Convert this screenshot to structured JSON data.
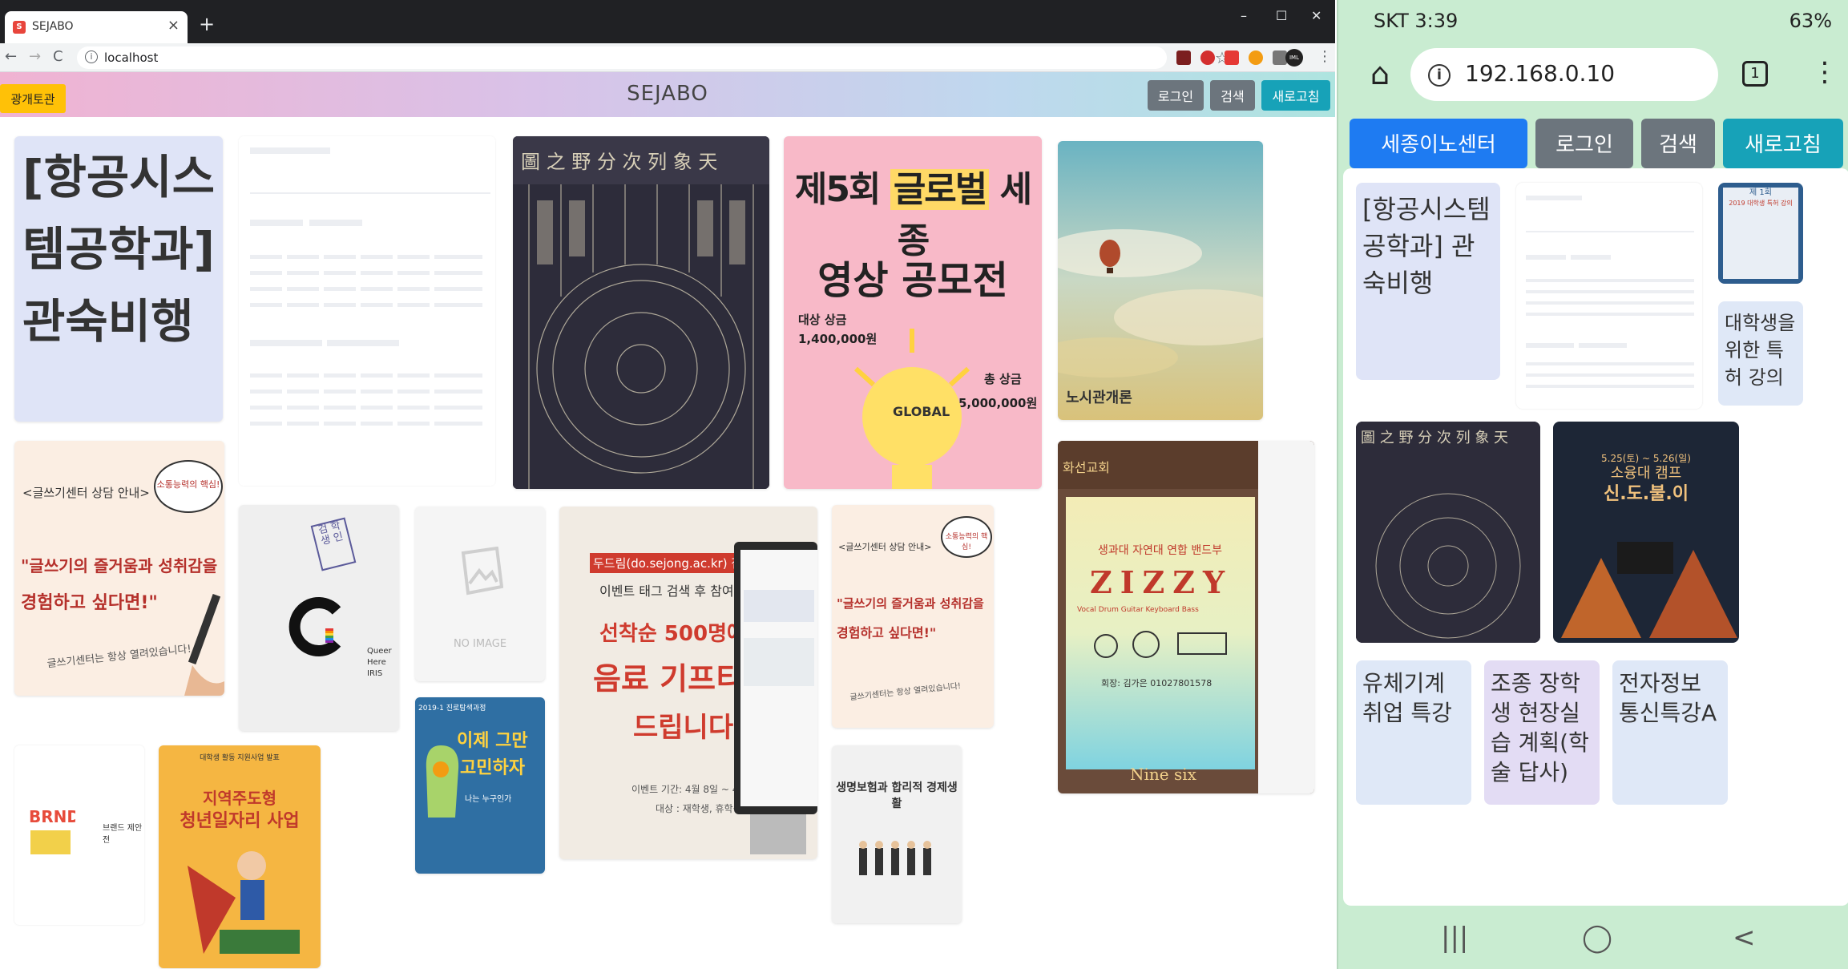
{
  "browser": {
    "tab_title": "SEJABO",
    "tab_close": "×",
    "new_tab": "+",
    "url": "localhost",
    "window_controls": {
      "minimize": "–",
      "maximize": "☐",
      "close": "✕"
    },
    "nav": {
      "back": "←",
      "forward": "→",
      "reload": "C"
    },
    "info": "i",
    "star": "☆",
    "profile": "IML",
    "menu": "⋮"
  },
  "app": {
    "title": "SEJABO",
    "yellow_button": "광개토관",
    "login_button": "로그인",
    "search_button": "검색",
    "refresh_button": "새로고침"
  },
  "desktop_cards": {
    "text_card": "[항공시스템공학과]관숙비행",
    "contest": {
      "line1": "제5회",
      "highlight": "글로벌",
      "line1b": "세종",
      "line2": "영상 공모전",
      "prize1_label": "대상 상금",
      "prize1": "1,400,000원",
      "total_label": "총 상금",
      "total": "5,000,000원",
      "bulb": "GLOBAL"
    },
    "sky": {
      "caption": "노시관개론"
    },
    "writing1": {
      "title": "<글쓰기센터 상담 안내>",
      "bubble": "소통능력의 핵심!",
      "body1": "\"글쓰기의 즐거움과 성취감을",
      "body2": "경험하고 싶다면!\"",
      "footer": "글쓰기센터는 항상 열려있습니다!"
    },
    "noimage": "NO IMAGE",
    "event": {
      "line1": "두드림(do.sejong.ac.kr) 접속 후",
      "line2": "이벤트 태그 검색 후 참여 하면",
      "line3": "선착순 500명에게",
      "line4": "음료 기프티콘",
      "line5": "드립니다",
      "footer1": "이벤트 기간: 4월 8일 ~ 4월 19일",
      "footer2": "대상 : 재학생, 휴학생"
    },
    "writing2": {
      "title": "<글쓰기센터 상담 안내>",
      "bubble": "소통능력의 핵심!",
      "body1": "\"글쓰기의 즐거움과 성취감을",
      "body2": "경험하고 싶다면!\"",
      "footer": "글쓰기센터는 항상 열려있습니다!"
    },
    "zizzy": {
      "top": "화선교회",
      "sub": "생과대 자연대 연합 밴드부",
      "name": "ZIZZY",
      "genre": "Vocal Drum Guitar Keyboard Bass",
      "contact": "회장: 김가은 01027801578",
      "bottom": "Nine six"
    },
    "queer": {
      "stamp": "검 학 생 인",
      "brand1": "Queer",
      "brand2": "Here",
      "brand3": "IRIS"
    },
    "think": {
      "top": "2019-1 진로탐색과정",
      "line1": "이제 그만",
      "line2": "고민하자",
      "line3": "나는 누구인가"
    },
    "job": {
      "top": "대학생 활동 지원사업 발표",
      "line1": "지역주도형",
      "line2": "청년일자리 사업"
    },
    "insurance": {
      "title": "생명보험과 합리적 경제생활"
    },
    "brand": {
      "label": "브랜드 제안전"
    }
  },
  "phone": {
    "time": "SKT 3:39",
    "battery": "63%",
    "url": "192.168.0.10",
    "tab_count": "1",
    "info": "i",
    "home": "⌂",
    "menu": "⋮",
    "buttons": {
      "place": "세종이노센터",
      "login": "로그인",
      "search": "검색",
      "refresh": "새로고침"
    },
    "cards": {
      "c1": "[항공시스템공학과] 관숙비행",
      "c2": "대학생을 위한 특허 강의",
      "c3": "유체기계 취업 특강",
      "c4": "조종 장학생 현장실습 계획(학술 답사)",
      "c5": "전자정보통신특강A",
      "camp_date": "5.25(토) ~ 5.26(일)",
      "camp_title": "소융대 캠프",
      "camp_name": "신.도.불.이",
      "patent_thumb_title": "제 1회",
      "patent_thumb_sub": "2019 대학생 특허 강의"
    },
    "nav": {
      "recent": "|||",
      "home": "◯",
      "back": "<"
    }
  }
}
